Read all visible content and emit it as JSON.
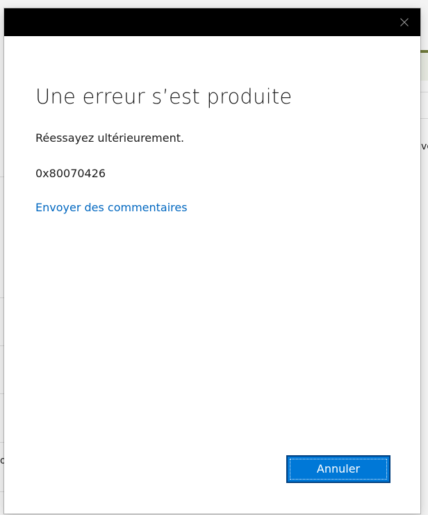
{
  "dialog": {
    "close_icon": "close-icon",
    "heading": "Une erreur s’est produite",
    "message": "Réessayez ultérieurement.",
    "error_code": "0x80070426",
    "feedback_link": "Envoyer des commentaires",
    "cancel_label": "Annuler"
  },
  "background": {
    "right_fragment": "ve",
    "left_fragment": "o"
  },
  "colors": {
    "titlebar": "#000000",
    "link": "#0067c0",
    "accent_button": "#0078d7",
    "button_border": "#003e7e"
  }
}
